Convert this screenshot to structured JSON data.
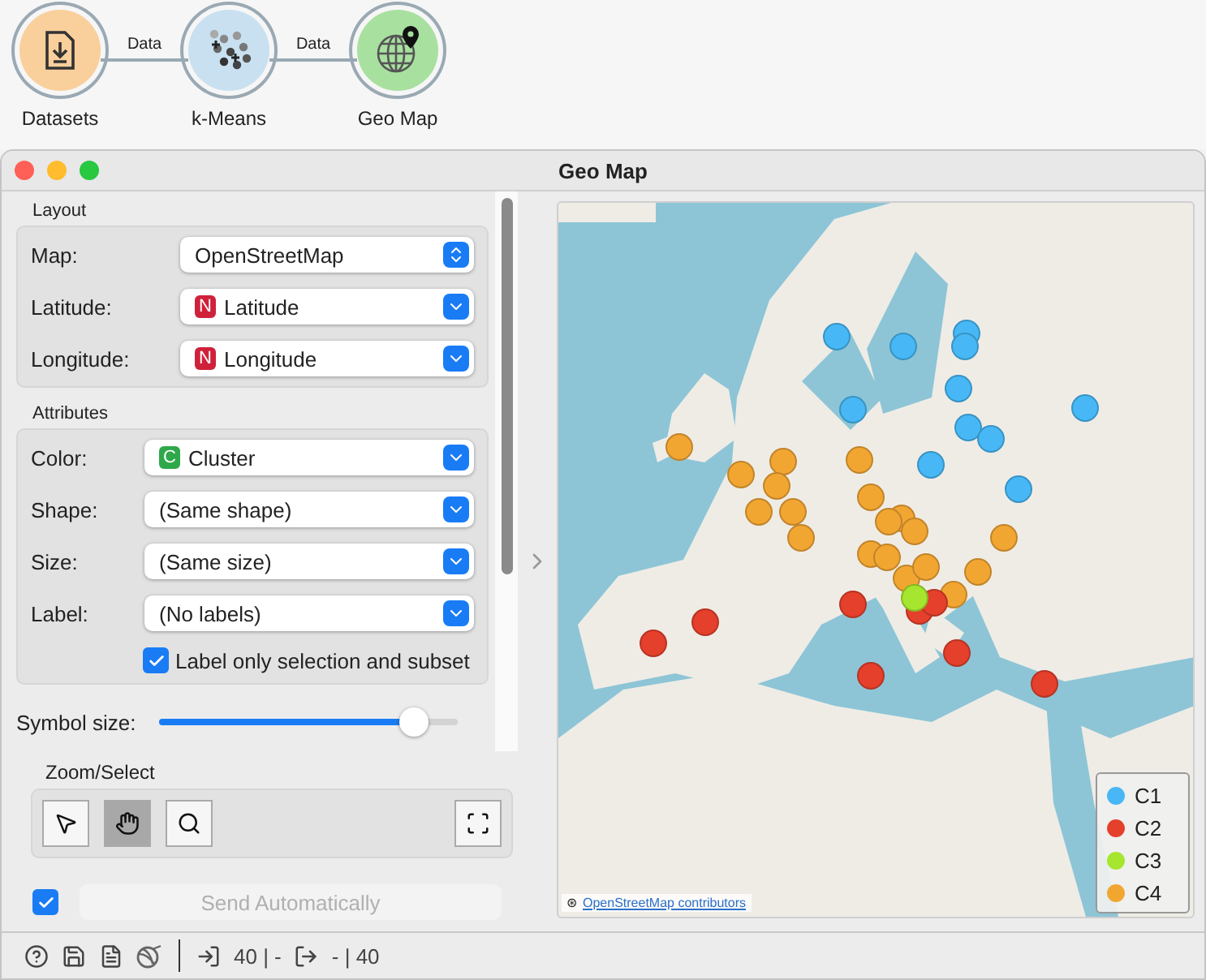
{
  "workflow": {
    "nodes": [
      {
        "label": "Datasets",
        "color": "#f9cf9b",
        "kind": "file"
      },
      {
        "label": "k-Means",
        "color": "#c9e0f0",
        "kind": "scatter"
      },
      {
        "label": "Geo Map",
        "color": "#a8e0a0",
        "kind": "globe"
      }
    ],
    "links": [
      "Data",
      "Data"
    ]
  },
  "window": {
    "title": "Geo Map"
  },
  "layout": {
    "title": "Layout",
    "rows": [
      {
        "label": "Map:",
        "value": "OpenStreetMap",
        "kind": "popup"
      },
      {
        "label": "Latitude:",
        "value": "Latitude",
        "badge": "N",
        "color": "#d0213b",
        "kind": "combo"
      },
      {
        "label": "Longitude:",
        "value": "Longitude",
        "badge": "N",
        "color": "#d0213b",
        "kind": "combo"
      }
    ]
  },
  "attributes": {
    "title": "Attributes",
    "rows": [
      {
        "label": "Color:",
        "value": "Cluster",
        "badge": "C",
        "color": "#2ea84a",
        "kind": "combo"
      },
      {
        "label": "Shape:",
        "value": "(Same shape)",
        "kind": "combo"
      },
      {
        "label": "Size:",
        "value": "(Same size)",
        "kind": "combo"
      },
      {
        "label": "Label:",
        "value": "(No labels)",
        "kind": "combo"
      }
    ],
    "label_only": {
      "label": "Label only selection and subset",
      "checked": true
    }
  },
  "symbol_size": {
    "label": "Symbol size:",
    "level": 0.9
  },
  "zoom_select": {
    "title": "Zoom/Select",
    "tools": [
      {
        "kind": "pointer",
        "selected": false
      },
      {
        "kind": "hand",
        "selected": true
      },
      {
        "kind": "zoom",
        "selected": false
      }
    ]
  },
  "send": {
    "label": "Send Automatically",
    "checked": true,
    "disabled": true
  },
  "map": {
    "attribution": "OpenStreetMap contributors",
    "attribution_mark": "⊛",
    "legend": [
      {
        "label": "C1",
        "color": "#47b8f5"
      },
      {
        "label": "C2",
        "color": "#e5402c"
      },
      {
        "label": "C3",
        "color": "#a6e62e"
      },
      {
        "label": "C4",
        "color": "#f2a632"
      }
    ]
  },
  "status_bar": {
    "input": "40 | -",
    "output": "- | 40"
  }
}
